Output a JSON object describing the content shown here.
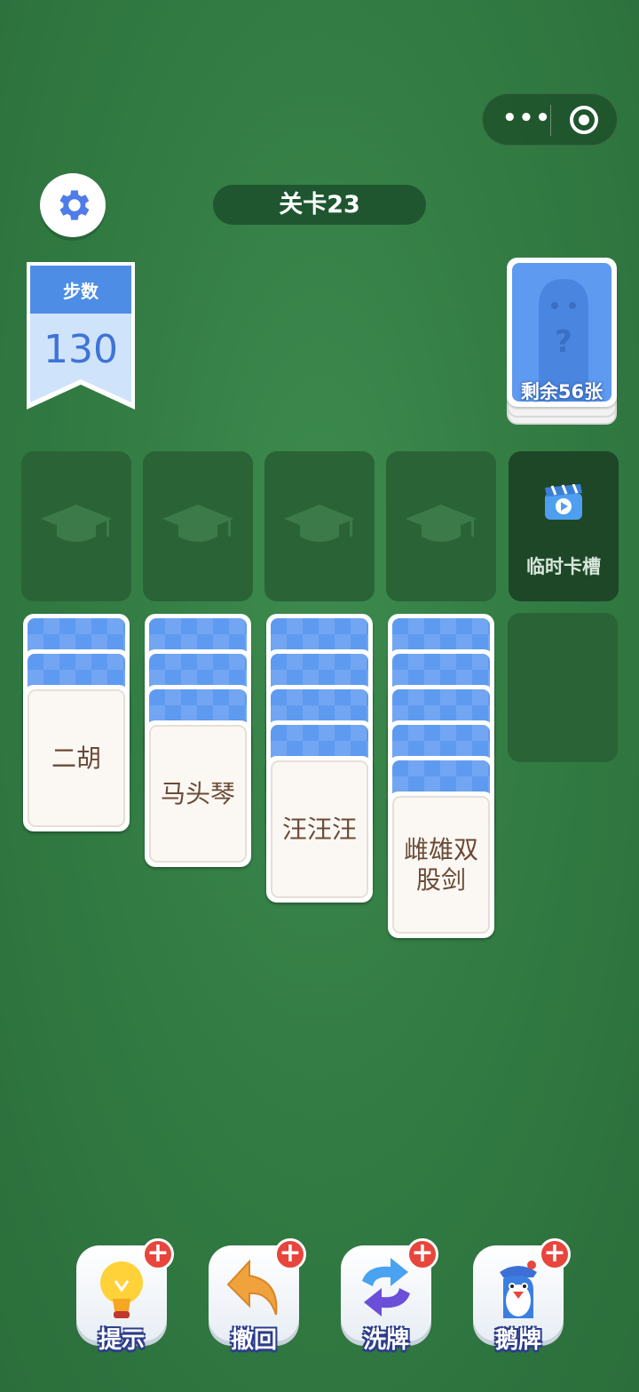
{
  "capsule": {
    "more": "•••"
  },
  "level": {
    "text": "关卡23"
  },
  "steps": {
    "label": "步数",
    "value": "130"
  },
  "deck": {
    "remaining": "剩余56张"
  },
  "temp_slot": {
    "label": "临时卡槽"
  },
  "columns": [
    {
      "hidden": 2,
      "face": "二胡"
    },
    {
      "hidden": 3,
      "face": "马头琴"
    },
    {
      "hidden": 4,
      "face": "汪汪汪"
    },
    {
      "hidden": 5,
      "face": "雌雄双股剑"
    }
  ],
  "tools": {
    "hint": "提示",
    "undo": "撤回",
    "shuffle": "洗牌",
    "goose": "鹅牌"
  },
  "colors": {
    "felt": "#317a42",
    "card_back": "#5e9af0",
    "slot": "#2a6436"
  }
}
